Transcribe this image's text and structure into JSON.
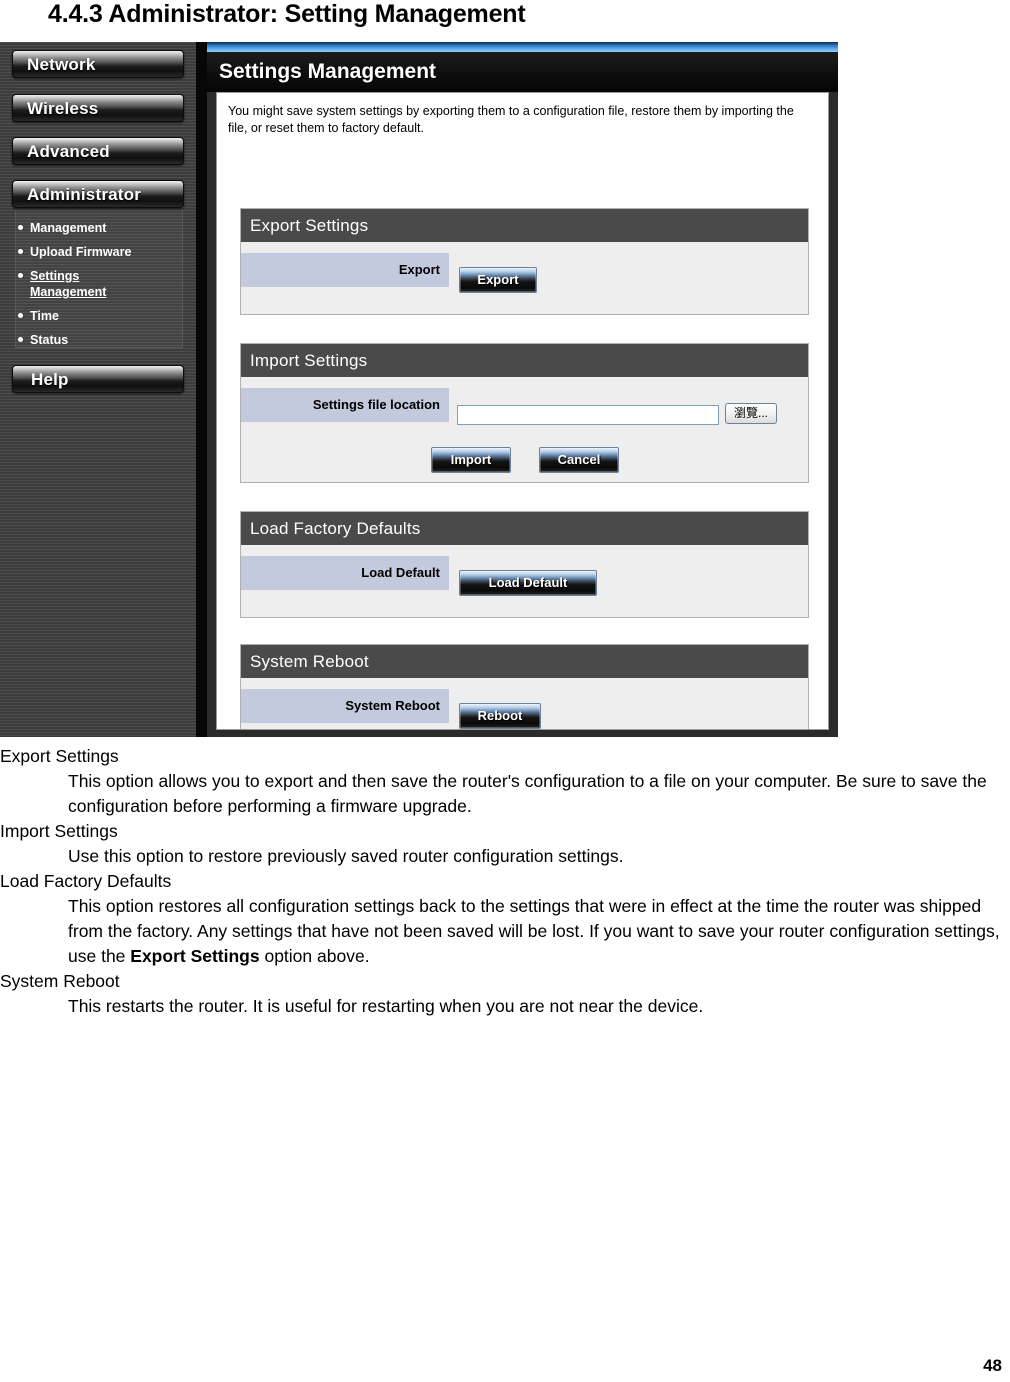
{
  "heading": "4.4.3 Administrator: Setting Management",
  "page_number": "48",
  "router_ui": {
    "nav_buttons": [
      {
        "label": "Network"
      },
      {
        "label": "Wireless"
      },
      {
        "label": "Advanced"
      },
      {
        "label": "Administrator"
      }
    ],
    "help_button": "Help",
    "sub_items": [
      {
        "label": "Management",
        "active": false
      },
      {
        "label": "Upload Firmware",
        "active": false
      },
      {
        "label": "Settings Management",
        "active": true
      },
      {
        "label": "Time",
        "active": false
      },
      {
        "label": "Status",
        "active": false
      }
    ],
    "panel_title": "Settings Management",
    "intro": "You might save system settings by exporting them to a configuration file, restore them by importing the file, or reset them to factory default.",
    "sections": {
      "export": {
        "title": "Export Settings",
        "field_label": "Export",
        "button": "Export"
      },
      "import": {
        "title": "Import Settings",
        "field_label": "Settings file location",
        "file_value": "",
        "browse_button": "瀏覽...",
        "import_button": "Import",
        "cancel_button": "Cancel"
      },
      "defaults": {
        "title": "Load Factory Defaults",
        "field_label": "Load Default",
        "button": "Load Default"
      },
      "reboot": {
        "title": "System Reboot",
        "field_label": "System Reboot",
        "button": "Reboot"
      }
    }
  },
  "descriptions": [
    {
      "term": "Export Settings",
      "text": "This option allows you to export and then save the router's configuration to a file on your computer. Be sure to save the configuration before performing a firmware upgrade.",
      "bold_part": ""
    },
    {
      "term": "Import Settings",
      "text": "Use this option to restore previously saved router configuration settings.",
      "bold_part": ""
    },
    {
      "term": "Load Factory Defaults",
      "text_before": "This option restores all configuration settings back to the settings that were in effect at the time the router was shipped from the factory. Any settings that have not been saved will be lost. If you want to save your router configuration settings, use the ",
      "bold_part": "Export Settings",
      "text_after": " option above."
    },
    {
      "term": "System Reboot",
      "text": "This restarts the router. It is useful for restarting when you are not near the device.",
      "bold_part": ""
    }
  ]
}
